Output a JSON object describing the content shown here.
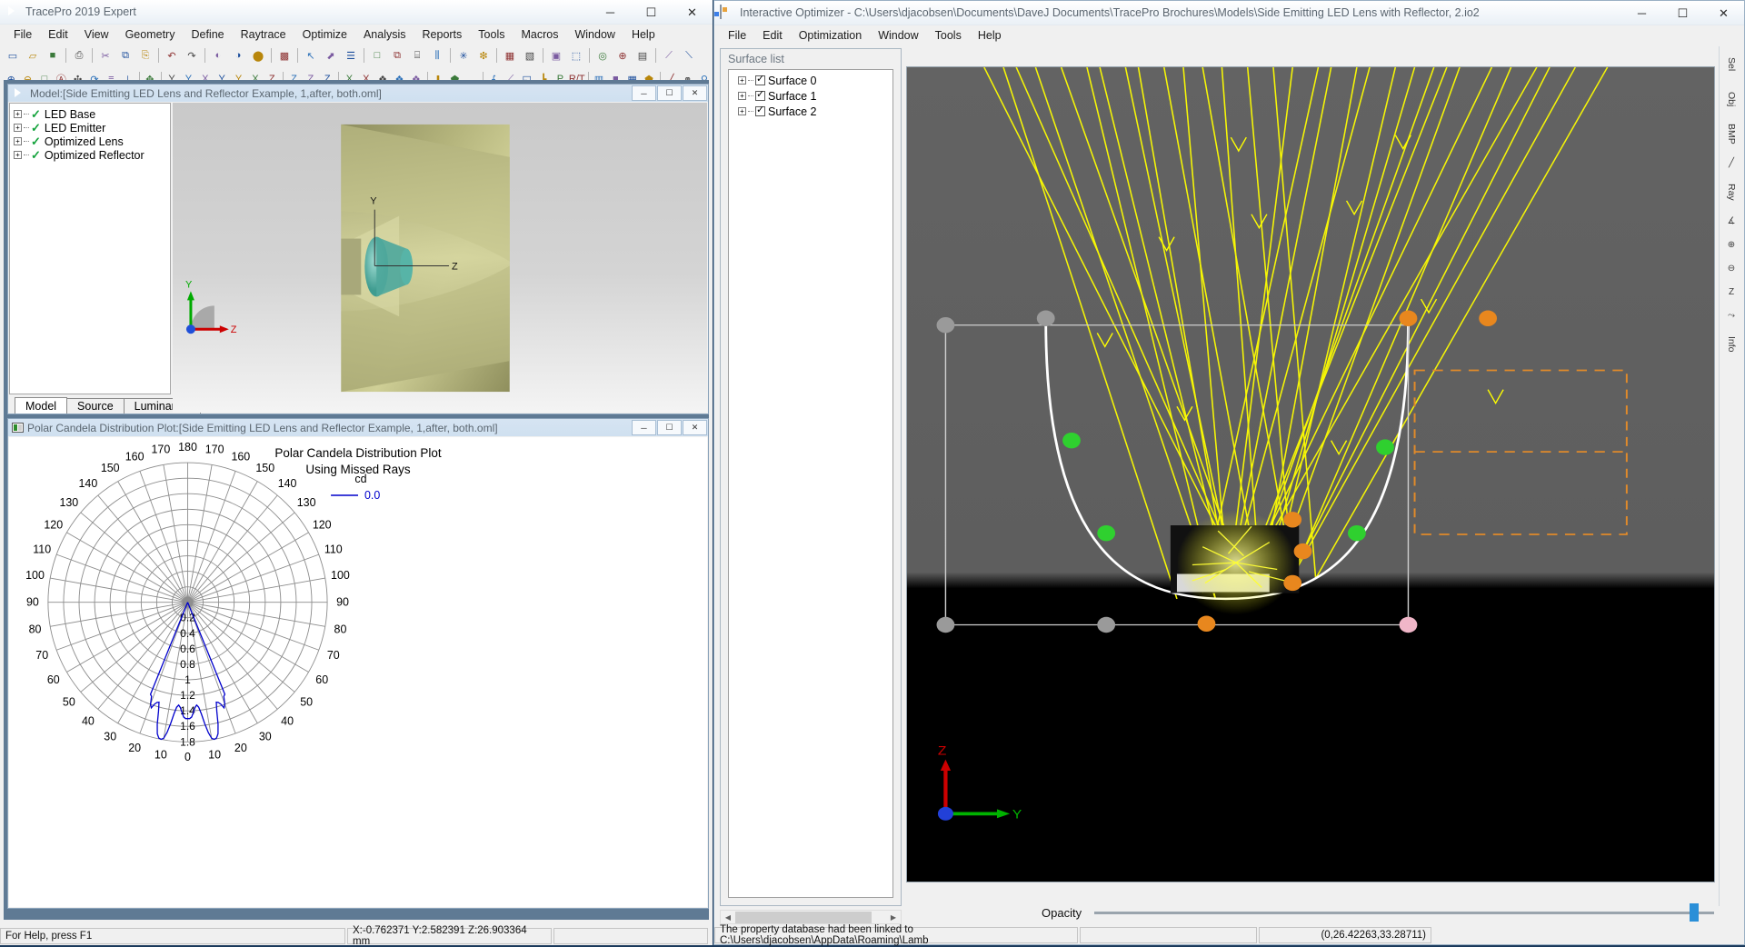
{
  "tracepro": {
    "title": "TracePro 2019 Expert",
    "app_icon": "tracepro-icon",
    "window_buttons": {
      "minimize": "─",
      "maximize": "☐",
      "close": "✕"
    },
    "menu": [
      "File",
      "Edit",
      "View",
      "Geometry",
      "Define",
      "Raytrace",
      "Optimize",
      "Analysis",
      "Reports",
      "Tools",
      "Macros",
      "Window",
      "Help"
    ],
    "toolbar_row1": [
      {
        "name": "new-file-icon",
        "glyph": "▭"
      },
      {
        "name": "open-file-icon",
        "glyph": "▱"
      },
      {
        "name": "save-icon",
        "glyph": "■"
      },
      {
        "sep": true
      },
      {
        "name": "print-icon",
        "glyph": "⎙"
      },
      {
        "sep": true
      },
      {
        "name": "cut-icon",
        "glyph": "✂"
      },
      {
        "name": "copy-icon",
        "glyph": "⧉"
      },
      {
        "name": "paste-icon",
        "glyph": "⎘"
      },
      {
        "sep": true
      },
      {
        "name": "undo-icon",
        "glyph": "↶"
      },
      {
        "name": "redo-icon",
        "glyph": "↷"
      },
      {
        "sep": true
      },
      {
        "name": "half-shade-icon",
        "glyph": "◐"
      },
      {
        "name": "shade-icon",
        "glyph": "◑"
      },
      {
        "name": "solid-shade-icon",
        "glyph": "⬤"
      },
      {
        "sep": true
      },
      {
        "name": "render-icon",
        "glyph": "▩"
      },
      {
        "sep": true
      },
      {
        "name": "select-arrow-icon",
        "glyph": "↖"
      },
      {
        "name": "select-edge-icon",
        "glyph": "⬈"
      },
      {
        "name": "text-list-icon",
        "glyph": "☰"
      },
      {
        "sep": true
      },
      {
        "name": "window-single-icon",
        "glyph": "□"
      },
      {
        "name": "window-cascade-icon",
        "glyph": "⧉"
      },
      {
        "name": "window-tile-horizontal-icon",
        "glyph": "⌸"
      },
      {
        "name": "window-tile-vertical-icon",
        "glyph": "⫼"
      },
      {
        "sep": true
      },
      {
        "name": "raytrace-icon",
        "glyph": "✳"
      },
      {
        "name": "reverse-raytrace-icon",
        "glyph": "❇"
      },
      {
        "sep": true
      },
      {
        "name": "irradiance-map-icon",
        "glyph": "▦"
      },
      {
        "name": "candela-map-icon",
        "glyph": "▧"
      },
      {
        "sep": true
      },
      {
        "name": "photo-real-icon",
        "glyph": "▣"
      },
      {
        "name": "3d-irradiance-icon",
        "glyph": "⬚"
      },
      {
        "sep": true
      },
      {
        "name": "polar-candela-icon",
        "glyph": "◎"
      },
      {
        "name": "candela-globe-icon",
        "glyph": "⊕"
      },
      {
        "name": "rectangular-candela-icon",
        "glyph": "▤"
      },
      {
        "sep": true
      },
      {
        "name": "sort-rays-icon",
        "glyph": "⟋"
      },
      {
        "name": "display-rays-icon",
        "glyph": "⟍"
      }
    ],
    "toolbar_row2": [
      {
        "name": "zoom-in-icon",
        "glyph": "⊕"
      },
      {
        "name": "zoom-out-icon",
        "glyph": "⊖"
      },
      {
        "name": "zoom-window-icon",
        "glyph": "□"
      },
      {
        "name": "zoom-all-icon",
        "glyph": "Ⓐ"
      },
      {
        "name": "pan-icon",
        "glyph": "✣"
      },
      {
        "name": "rotate-icon",
        "glyph": "⟳"
      },
      {
        "name": "list-view-icon",
        "glyph": "≡"
      },
      {
        "name": "align-icon",
        "glyph": "⊥"
      },
      {
        "sep": true
      },
      {
        "name": "axis-move-icon",
        "glyph": "✥"
      },
      {
        "sep": true
      },
      {
        "name": "view-yz-icon",
        "glyph": "Y"
      },
      {
        "name": "view-y-icon",
        "glyph": "Y"
      },
      {
        "name": "view-xz-icon",
        "glyph": "X"
      },
      {
        "name": "view-yx-icon",
        "glyph": "Y"
      },
      {
        "name": "view-ny-icon",
        "glyph": "Y"
      },
      {
        "name": "view-nx-icon",
        "glyph": "X"
      },
      {
        "name": "view-z-icon",
        "glyph": "Z"
      },
      {
        "sep": true
      },
      {
        "name": "view-z2-icon",
        "glyph": "Z"
      },
      {
        "name": "view-z3-icon",
        "glyph": "Z"
      },
      {
        "name": "view-z4-icon",
        "glyph": "Z"
      },
      {
        "sep": true
      },
      {
        "name": "view-x1-icon",
        "glyph": "X"
      },
      {
        "name": "view-x2-icon",
        "glyph": "X"
      },
      {
        "name": "view-iso-icon",
        "glyph": "❖"
      },
      {
        "name": "view-iso2-icon",
        "glyph": "❖"
      },
      {
        "name": "view-iso3-icon",
        "glyph": "❖"
      },
      {
        "sep": true
      },
      {
        "name": "import-down-icon",
        "glyph": "⬇"
      },
      {
        "name": "apply-green-icon",
        "glyph": "⬟"
      },
      {
        "name": "bar-icon",
        "glyph": "▁"
      },
      {
        "sep": true
      },
      {
        "name": "flux-report-icon",
        "glyph": "⨍"
      },
      {
        "name": "incident-ray-icon",
        "glyph": "⟋"
      },
      {
        "name": "polarization-icon",
        "glyph": "◱"
      },
      {
        "name": "rays-source-icon",
        "glyph": "┗"
      },
      {
        "name": "p-button-icon",
        "glyph": "P"
      },
      {
        "name": "rt-button-icon",
        "glyph": "R/T"
      },
      {
        "sep": true
      },
      {
        "name": "table-icon",
        "glyph": "▥"
      },
      {
        "name": "filled-square-icon",
        "glyph": "■"
      },
      {
        "name": "spectrum-icon",
        "glyph": "▦"
      },
      {
        "name": "prism-icon",
        "glyph": "⬟"
      },
      {
        "sep": true
      },
      {
        "name": "red-pen-icon",
        "glyph": "╱"
      },
      {
        "name": "chain-icon",
        "glyph": "⚭"
      },
      {
        "name": "magnifier-icon",
        "glyph": "⚲"
      }
    ],
    "model_window": {
      "icon": "tracepro-icon",
      "title": "Model:[Side Emitting LED Lens and Reflector Example, 1,after, both.oml]",
      "buttons": {
        "minimize": "─",
        "maximize": "☐",
        "close": "✕"
      },
      "tree": [
        {
          "label": "LED Base",
          "checked": true,
          "expander": "+"
        },
        {
          "label": "LED Emitter",
          "checked": true,
          "expander": "+"
        },
        {
          "label": "Optimized Lens",
          "checked": true,
          "expander": "+"
        },
        {
          "label": "Optimized Reflector",
          "checked": true,
          "expander": "+"
        }
      ],
      "tabs": [
        {
          "label": "Model",
          "active": true
        },
        {
          "label": "Source",
          "active": false
        },
        {
          "label": "Luminance",
          "active": false
        }
      ],
      "axes_3d": {
        "y": "Y",
        "z": "Z"
      },
      "axes_triad": {
        "y": "Y",
        "z": "Z"
      }
    },
    "plot_window": {
      "icon": "plot-icon",
      "title": "Polar Candela Distribution Plot:[Side Emitting LED Lens and Reflector Example, 1,after, both.oml]",
      "buttons": {
        "minimize": "─",
        "maximize": "☐",
        "close": "✕"
      }
    },
    "status": {
      "hint": "For Help, press F1",
      "coords": "X:-0.762371 Y:2.582391 Z:26.903364 mm",
      "extra": ""
    }
  },
  "chart_data": {
    "type": "polar",
    "title": "Polar Candela Distribution Plot",
    "subtitle": "Using Missed Rays",
    "angle_labels_left": [
      180,
      170,
      160,
      150,
      140,
      130,
      120,
      110,
      100,
      90,
      80,
      70,
      60,
      50,
      40,
      30,
      20,
      10
    ],
    "angle_labels_right": [
      170,
      160,
      150,
      140,
      130,
      120,
      110,
      100,
      90,
      80,
      70,
      60,
      50,
      40,
      30,
      20,
      10
    ],
    "center_label": "0",
    "radial_ticks": [
      "0.2",
      "0.4",
      "0.6",
      "0.8",
      "1",
      "1.2",
      "1.4",
      "1.6",
      "1.8"
    ],
    "rmax": 1.8,
    "legend": {
      "header": "cd",
      "entries": [
        {
          "label": "0.0",
          "color": "#0000cc"
        }
      ]
    },
    "series_color": "#0000cc",
    "grid": true,
    "angular_spacing_deg": 10,
    "radial_rings": 9,
    "curve_deg_r": [
      [
        -22,
        1.28
      ],
      [
        -21,
        1.3
      ],
      [
        -20,
        1.4
      ],
      [
        -19,
        1.44
      ],
      [
        -18,
        1.38
      ],
      [
        -17,
        1.35
      ],
      [
        -16,
        1.34
      ],
      [
        -15,
        1.45
      ],
      [
        -14,
        1.62
      ],
      [
        -13,
        1.74
      ],
      [
        -12,
        1.79
      ],
      [
        -11,
        1.8
      ],
      [
        -10,
        1.78
      ],
      [
        -9,
        1.7
      ],
      [
        -8,
        1.58
      ],
      [
        -7,
        1.45
      ],
      [
        -6,
        1.36
      ],
      [
        -5,
        1.33
      ],
      [
        -4,
        1.36
      ],
      [
        -3,
        1.42
      ],
      [
        -2,
        1.48
      ],
      [
        -1,
        1.5
      ],
      [
        0,
        1.5
      ],
      [
        1,
        1.5
      ],
      [
        2,
        1.48
      ],
      [
        3,
        1.42
      ],
      [
        4,
        1.36
      ],
      [
        5,
        1.33
      ],
      [
        6,
        1.36
      ],
      [
        7,
        1.45
      ],
      [
        8,
        1.58
      ],
      [
        9,
        1.7
      ],
      [
        10,
        1.78
      ],
      [
        11,
        1.8
      ],
      [
        12,
        1.79
      ],
      [
        13,
        1.74
      ],
      [
        14,
        1.62
      ],
      [
        15,
        1.45
      ],
      [
        16,
        1.34
      ],
      [
        17,
        1.35
      ],
      [
        18,
        1.38
      ],
      [
        19,
        1.44
      ],
      [
        20,
        1.4
      ],
      [
        21,
        1.3
      ],
      [
        22,
        1.28
      ]
    ]
  },
  "optimizer": {
    "title": "Interactive Optimizer - C:\\Users\\djacobsen\\Documents\\DaveJ Documents\\TracePro Brochures\\Models\\Side Emitting LED Lens with Reflector, 2.io2",
    "app_icon": "optimizer-icon",
    "window_buttons": {
      "minimize": "─",
      "maximize": "☐",
      "close": "✕"
    },
    "menu": [
      "File",
      "Edit",
      "Optimization",
      "Window",
      "Tools",
      "Help"
    ],
    "surface_panel": {
      "label": "Surface list",
      "items": [
        {
          "label": "Surface 0",
          "checked": true,
          "expander": "+"
        },
        {
          "label": "Surface 1",
          "checked": true,
          "expander": "+"
        },
        {
          "label": "Surface 2",
          "checked": true,
          "expander": "+"
        }
      ]
    },
    "opacity": {
      "label": "Opacity",
      "value": 96
    },
    "vertical_toolbar": [
      {
        "name": "tab-sel",
        "label": "Sel"
      },
      {
        "name": "tab-obj",
        "label": "Obj"
      },
      {
        "name": "tab-bmp",
        "label": "BMP"
      },
      {
        "name": "measure-line-icon",
        "label": ""
      },
      {
        "name": "tab-ray",
        "label": "Ray"
      },
      {
        "name": "angle-icon",
        "label": ""
      },
      {
        "name": "zoom-in-icon",
        "label": ""
      },
      {
        "name": "zoom-out-icon",
        "label": ""
      },
      {
        "name": "axis-z-icon",
        "label": ""
      },
      {
        "name": "axis-xz-icon",
        "label": ""
      },
      {
        "name": "tab-info",
        "label": "Info"
      }
    ],
    "status": {
      "message": "The property database had been linked to C:\\Users\\djacobsen\\AppData\\Roaming\\Lamb",
      "coords": "(0,26.42263,33.28711)"
    }
  }
}
